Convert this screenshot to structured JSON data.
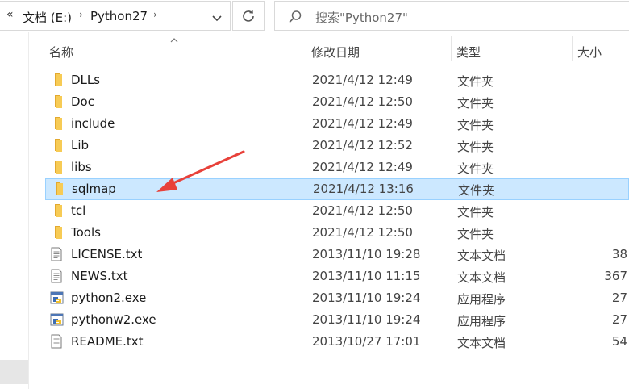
{
  "address_bar": {
    "overflow_icon": "chevron-double-left-icon",
    "crumbs": [
      "文档 (E:)",
      "Python27"
    ],
    "dropdown_icon": "chevron-down-icon"
  },
  "refresh_icon": "refresh-icon",
  "search": {
    "placeholder": "搜索\"Python27\"",
    "icon": "search-icon"
  },
  "columns": {
    "name": "名称",
    "modified": "修改日期",
    "type": "类型",
    "size": "大小"
  },
  "files": [
    {
      "name": "DLLs",
      "modified": "2021/4/12 12:49",
      "type": "文件夹",
      "size": "",
      "icon": "folder-icon",
      "selected": false
    },
    {
      "name": "Doc",
      "modified": "2021/4/12 12:50",
      "type": "文件夹",
      "size": "",
      "icon": "folder-icon",
      "selected": false
    },
    {
      "name": "include",
      "modified": "2021/4/12 12:49",
      "type": "文件夹",
      "size": "",
      "icon": "folder-icon",
      "selected": false
    },
    {
      "name": "Lib",
      "modified": "2021/4/12 12:52",
      "type": "文件夹",
      "size": "",
      "icon": "folder-icon",
      "selected": false
    },
    {
      "name": "libs",
      "modified": "2021/4/12 12:49",
      "type": "文件夹",
      "size": "",
      "icon": "folder-icon",
      "selected": false
    },
    {
      "name": "sqlmap",
      "modified": "2021/4/12 13:16",
      "type": "文件夹",
      "size": "",
      "icon": "folder-icon",
      "selected": true
    },
    {
      "name": "tcl",
      "modified": "2021/4/12 12:50",
      "type": "文件夹",
      "size": "",
      "icon": "folder-icon",
      "selected": false
    },
    {
      "name": "Tools",
      "modified": "2021/4/12 12:50",
      "type": "文件夹",
      "size": "",
      "icon": "folder-icon",
      "selected": false
    },
    {
      "name": "LICENSE.txt",
      "modified": "2013/11/10 19:28",
      "type": "文本文档",
      "size": "38",
      "icon": "text-file-icon",
      "selected": false
    },
    {
      "name": "NEWS.txt",
      "modified": "2013/11/10 11:15",
      "type": "文本文档",
      "size": "367",
      "icon": "text-file-icon",
      "selected": false
    },
    {
      "name": "python2.exe",
      "modified": "2013/11/10 19:24",
      "type": "应用程序",
      "size": "27",
      "icon": "python-exe-icon",
      "selected": false
    },
    {
      "name": "pythonw2.exe",
      "modified": "2013/11/10 19:24",
      "type": "应用程序",
      "size": "27",
      "icon": "python-exe-icon",
      "selected": false
    },
    {
      "name": "README.txt",
      "modified": "2013/10/27 17:01",
      "type": "文本文档",
      "size": "54",
      "icon": "text-file-icon",
      "selected": false
    }
  ],
  "colors": {
    "selection_bg": "#cce8ff",
    "selection_border": "#99d1ff",
    "folder": "#f4c54a",
    "annotation_arrow": "#e8413a"
  }
}
